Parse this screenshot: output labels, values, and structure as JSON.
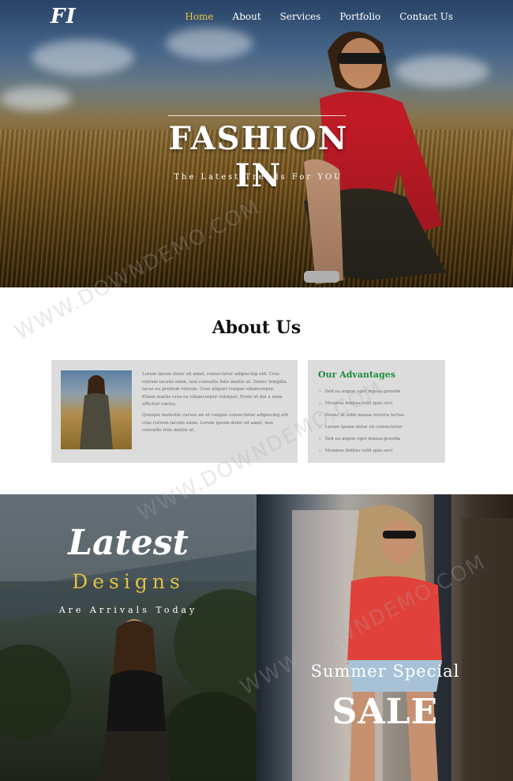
{
  "brand": {
    "logo": "FI"
  },
  "nav": {
    "items": [
      {
        "label": "Home",
        "active": true
      },
      {
        "label": "About"
      },
      {
        "label": "Services"
      },
      {
        "label": "Portfolio"
      },
      {
        "label": "Contact Us"
      }
    ]
  },
  "hero": {
    "title": "FASHION IN",
    "subtitle": "The Latest Trends For YOU"
  },
  "about": {
    "title": "About Us",
    "paragraphs": [
      "Lorem ipsum dolor sit amet, consectetur adipiscing elit. Cras rutrum iaculis enim, non convallis felis mattis at. Donec fringilla lacus eu pretium rutrum. Cras aliquet congue ullamcorper. Etiam mattis eros eu ullamcorper volutpat. Proin ut dui a urna efficitur varius.",
      "Quisque molestie cursus mi et congue consectetur adipiscing elit cras rutrum iaculis enim. Lorem ipsum dolor sit amet, non convallis felis mattis at."
    ],
    "advantages": {
      "title": "Our Advantages",
      "items": [
        "Sed eu augue eget massa gravida",
        "Vivamus finibus velit quis orci",
        "Donec at nibh massa viverra luctus.",
        "Lorem ipsum dolor sit consectetur",
        "Sed eu augue eget massa gravida",
        "Vivamus finibus velit quis orci"
      ]
    }
  },
  "promo": {
    "latest": "Latest",
    "designs": "Designs",
    "arrivals": "Are Arrivals Today",
    "summer": "Summer Special",
    "sale": "SALE"
  },
  "watermark": "WWW.DOWNDEMO.COM",
  "colors": {
    "nav_active": "#e7c544",
    "advantages_title": "#1c8c3c",
    "designs_text": "#e2c142",
    "card_bg": "#dcdcdc"
  }
}
